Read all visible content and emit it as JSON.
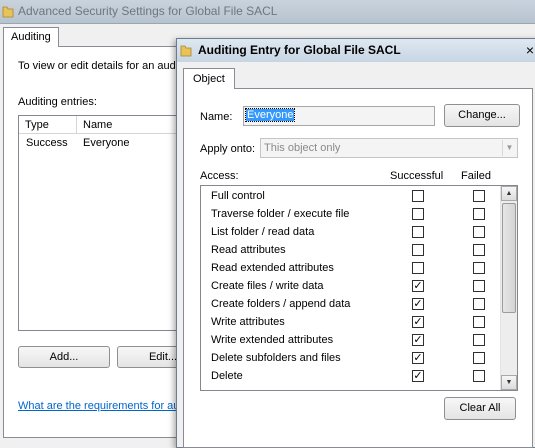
{
  "background_window": {
    "title": "Advanced Security Settings for Global File SACL",
    "tab": "Auditing",
    "description": "To view or edit details for an aud",
    "entries_label": "Auditing entries:",
    "columns": [
      "Type",
      "Name"
    ],
    "entries": [
      {
        "type": "Success",
        "name": "Everyone"
      }
    ],
    "add_label": "Add...",
    "edit_label": "Edit...",
    "link_text": "What are the requirements for au"
  },
  "dialog": {
    "title": "Auditing Entry for Global File SACL",
    "close_glyph": "×",
    "tab": "Object",
    "name_label": "Name:",
    "name_value": "Everyone",
    "change_label": "Change...",
    "apply_label": "Apply onto:",
    "apply_value": "This object only",
    "access_label": "Access:",
    "successful_label": "Successful",
    "failed_label": "Failed",
    "clear_all_label": "Clear All",
    "check_glyph": "✓",
    "permissions": [
      {
        "name": "Full control",
        "successful": false,
        "failed": false
      },
      {
        "name": "Traverse folder / execute file",
        "successful": false,
        "failed": false
      },
      {
        "name": "List folder / read data",
        "successful": false,
        "failed": false
      },
      {
        "name": "Read attributes",
        "successful": false,
        "failed": false
      },
      {
        "name": "Read extended attributes",
        "successful": false,
        "failed": false
      },
      {
        "name": "Create files / write data",
        "successful": true,
        "failed": false
      },
      {
        "name": "Create folders / append data",
        "successful": true,
        "failed": false
      },
      {
        "name": "Write attributes",
        "successful": true,
        "failed": false
      },
      {
        "name": "Write extended attributes",
        "successful": true,
        "failed": false
      },
      {
        "name": "Delete subfolders and files",
        "successful": true,
        "failed": false
      },
      {
        "name": "Delete",
        "successful": true,
        "failed": false
      }
    ]
  },
  "icons": {
    "window_icon": "folder-icon",
    "scroll_up": "arrow-up-icon",
    "scroll_down": "arrow-down-icon",
    "dropdown": "chevron-down-icon"
  },
  "colors": {
    "selection": "#3399ff",
    "link": "#0066cc",
    "folder": "#e8c35a"
  }
}
